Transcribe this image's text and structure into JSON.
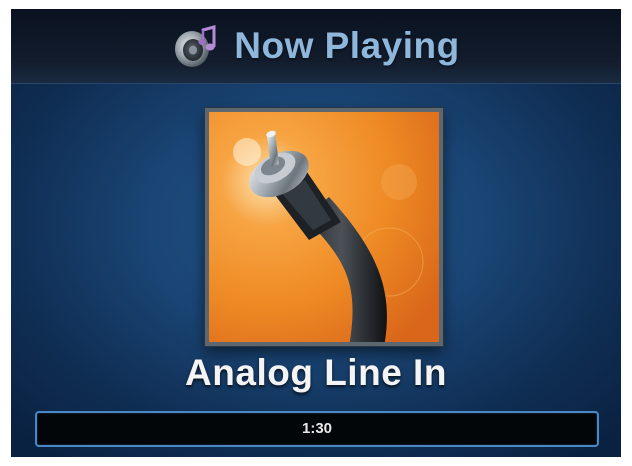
{
  "header": {
    "title": "Now Playing",
    "icon": "speaker-music-note-icon"
  },
  "now_playing": {
    "album_art_icon": "rca-cable-icon",
    "track_title": "Analog Line In",
    "elapsed_time": "1:30"
  },
  "colors": {
    "title_text": "#8fb7dc",
    "background": "#1a4575",
    "header_background": "#121c2c",
    "progress_border": "#4a88c4",
    "album_orange": "#f0902a"
  }
}
